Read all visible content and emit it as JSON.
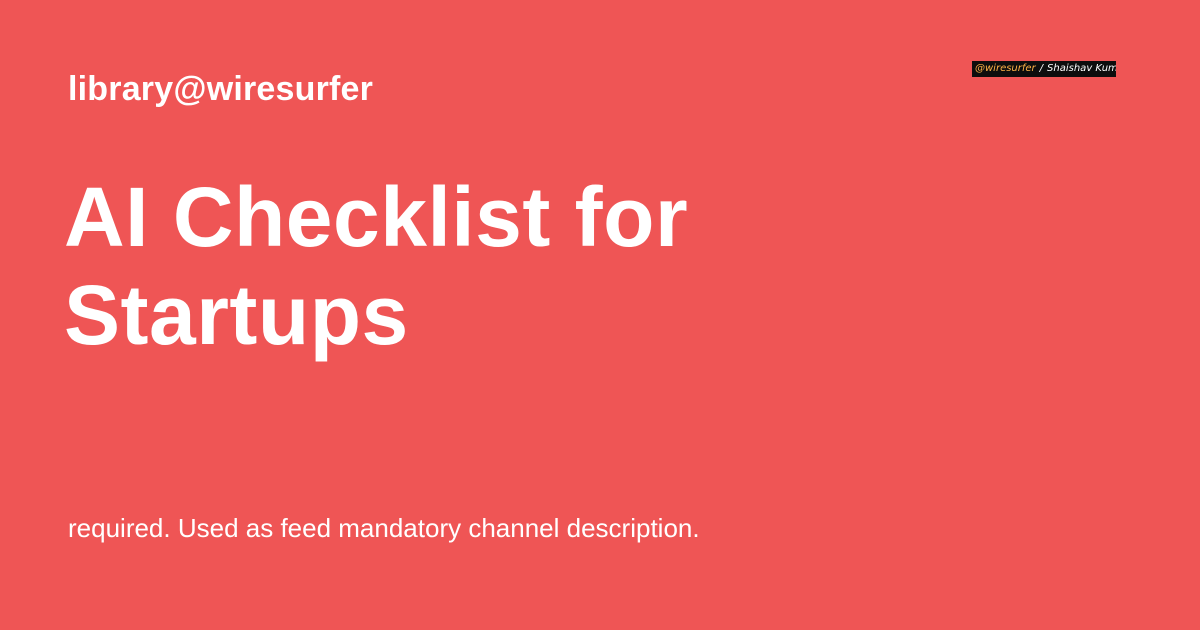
{
  "header": {
    "site_name": "library@wiresurfer"
  },
  "main": {
    "title": "AI Checklist for Startups",
    "description": "required. Used as feed mandatory channel description."
  },
  "badge": {
    "handle": "@wiresurfer",
    "separator": "/",
    "author": "Shaishav Kumar"
  },
  "colors": {
    "background": "#ef5555",
    "text": "#ffffff",
    "badge_background": "#0d0d0d",
    "badge_handle": "#ffb347"
  }
}
